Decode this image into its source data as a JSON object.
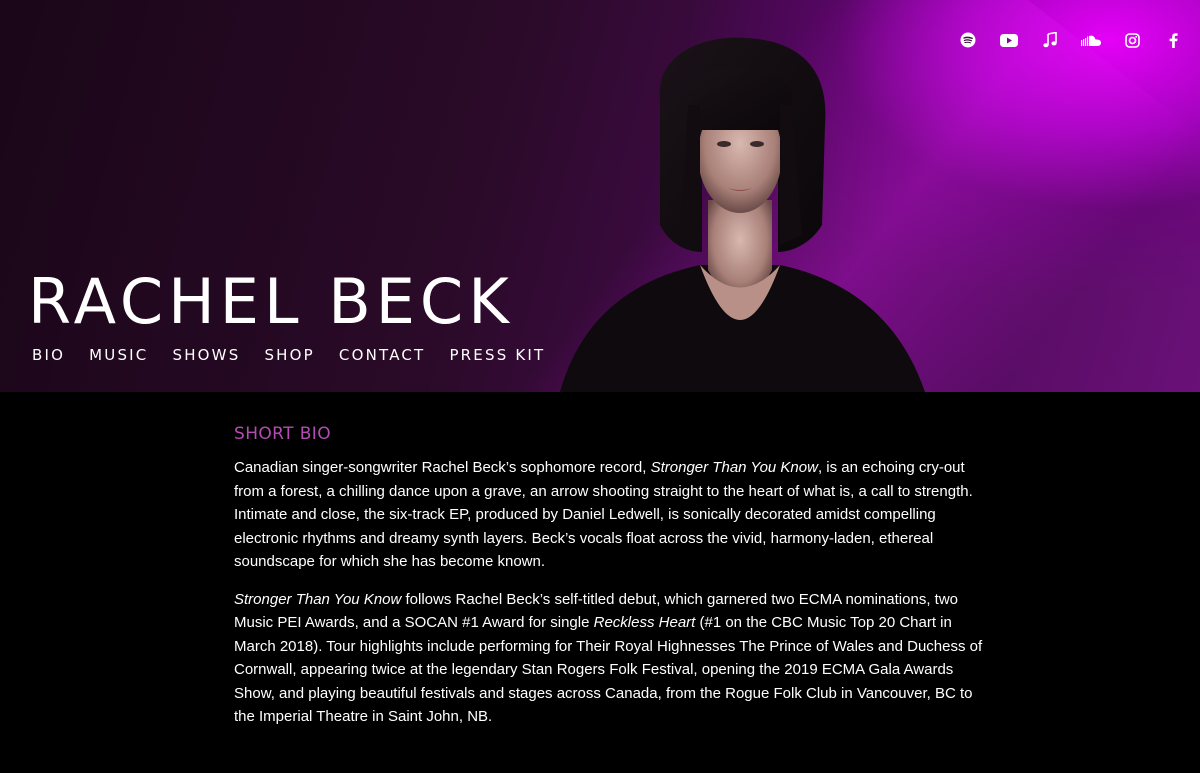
{
  "header": {
    "artist_name": "RACHEL BECK",
    "nav": [
      {
        "label": "BIO"
      },
      {
        "label": "MUSIC"
      },
      {
        "label": "SHOWS"
      },
      {
        "label": "SHOP"
      },
      {
        "label": "CONTACT"
      },
      {
        "label": "PRESS KIT"
      }
    ],
    "social_icons": [
      "spotify-icon",
      "youtube-icon",
      "apple-music-icon",
      "soundcloud-icon",
      "instagram-icon",
      "facebook-icon"
    ]
  },
  "bio": {
    "section_title": "SHORT BIO",
    "p1": {
      "t1": "Canadian singer-songwriter Rachel Beck’s sophomore record, ",
      "i1": "Stronger Than You Know",
      "t2": ", is an echoing cry-out from a forest, a chilling dance upon a grave, an arrow shooting straight to the heart of what is, a call to strength. Intimate and close, the six-track EP, produced by Daniel Ledwell, is sonically decorated amidst compelling electronic rhythms and dreamy synth layers. Beck’s vocals float across the vivid, harmony-laden, ethereal soundscape for which she has become known."
    },
    "p2": {
      "i1": "Stronger Than You Know",
      "t1": " follows Rachel Beck’s self-titled debut, which garnered two ECMA nominations, two Music PEI Awards, and a SOCAN #1 Award for single ",
      "i2": "Reckless Heart",
      "t2": " (#1 on the CBC Music Top 20 Chart in March 2018). Tour highlights include performing for Their Royal Highnesses The Prince of Wales and Duchess of Cornwall, appearing twice at the legendary Stan Rogers Folk Festival, opening the 2019 ECMA Gala Awards Show, and playing beautiful festivals and stages across Canada, from the Rogue Folk Club in Vancouver, BC to the Imperial Theatre in Saint John, NB."
    }
  },
  "colors": {
    "background": "#000000",
    "accent": "#b44cb4",
    "hero_glow": "#ec00ff",
    "text": "#ffffff"
  }
}
